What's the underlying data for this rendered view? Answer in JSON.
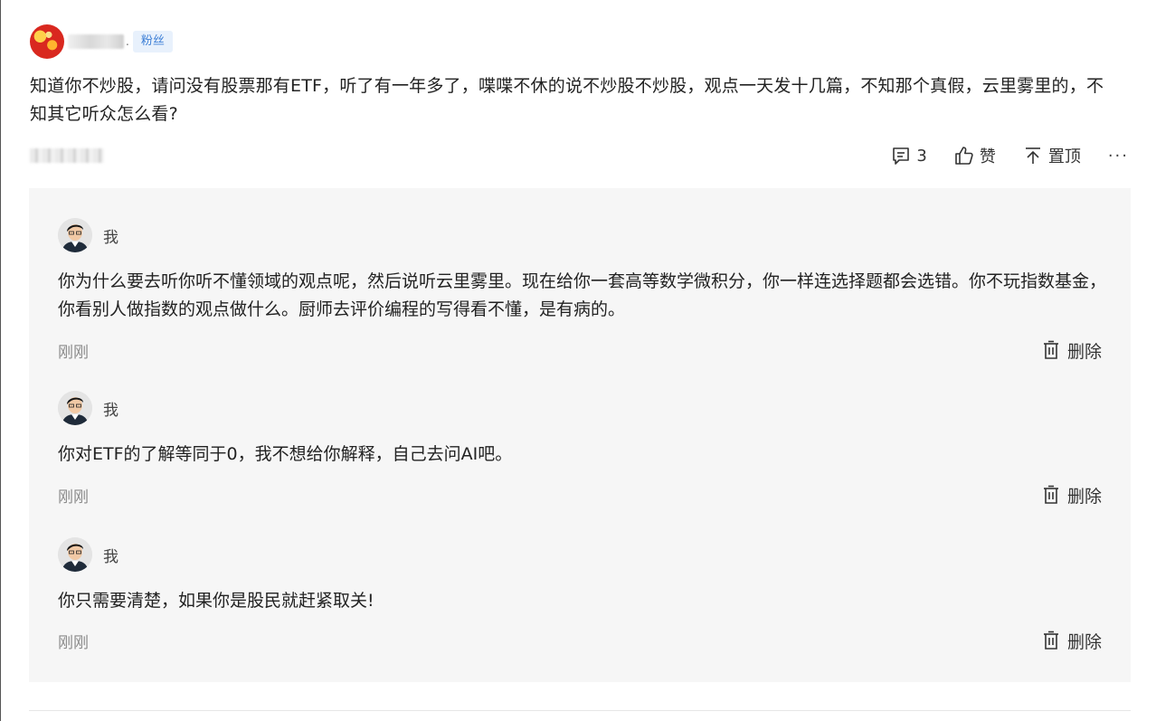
{
  "comment": {
    "badge": "粉丝",
    "dot": ".",
    "text": "知道你不炒股，请问没有股票那有ETF，听了有一年多了，喋喋不休的说不炒股不炒股，观点一天发十几篇，不知那个真假，云里雾里的，不知其它听众怎么看?",
    "actions": {
      "comment_count": "3",
      "like_label": "赞",
      "pin_label": "置顶",
      "more_label": "···"
    }
  },
  "replies": [
    {
      "name": "我",
      "text": "你为什么要去听你听不懂领域的观点呢，然后说听云里雾里。现在给你一套高等数学微积分，你一样连选择题都会选错。你不玩指数基金，你看别人做指数的观点做什么。厨师去评价编程的写得看不懂，是有病的。",
      "time": "刚刚",
      "delete_label": "删除"
    },
    {
      "name": "我",
      "text": "你对ETF的了解等同于0，我不想给你解释，自己去问AI吧。",
      "time": "刚刚",
      "delete_label": "删除"
    },
    {
      "name": "我",
      "text": "你只需要清楚，如果你是股民就赶紧取关!",
      "time": "刚刚",
      "delete_label": "删除"
    }
  ],
  "colors": {
    "badge_bg": "#e8f1fc",
    "badge_text": "#3d7fd6",
    "reply_bg": "#f6f6f6",
    "time_text": "#8a8a8a"
  },
  "icons": {
    "comment": "comment-icon",
    "like": "thumbs-up-icon",
    "pin": "pin-top-icon",
    "delete": "trash-icon"
  }
}
